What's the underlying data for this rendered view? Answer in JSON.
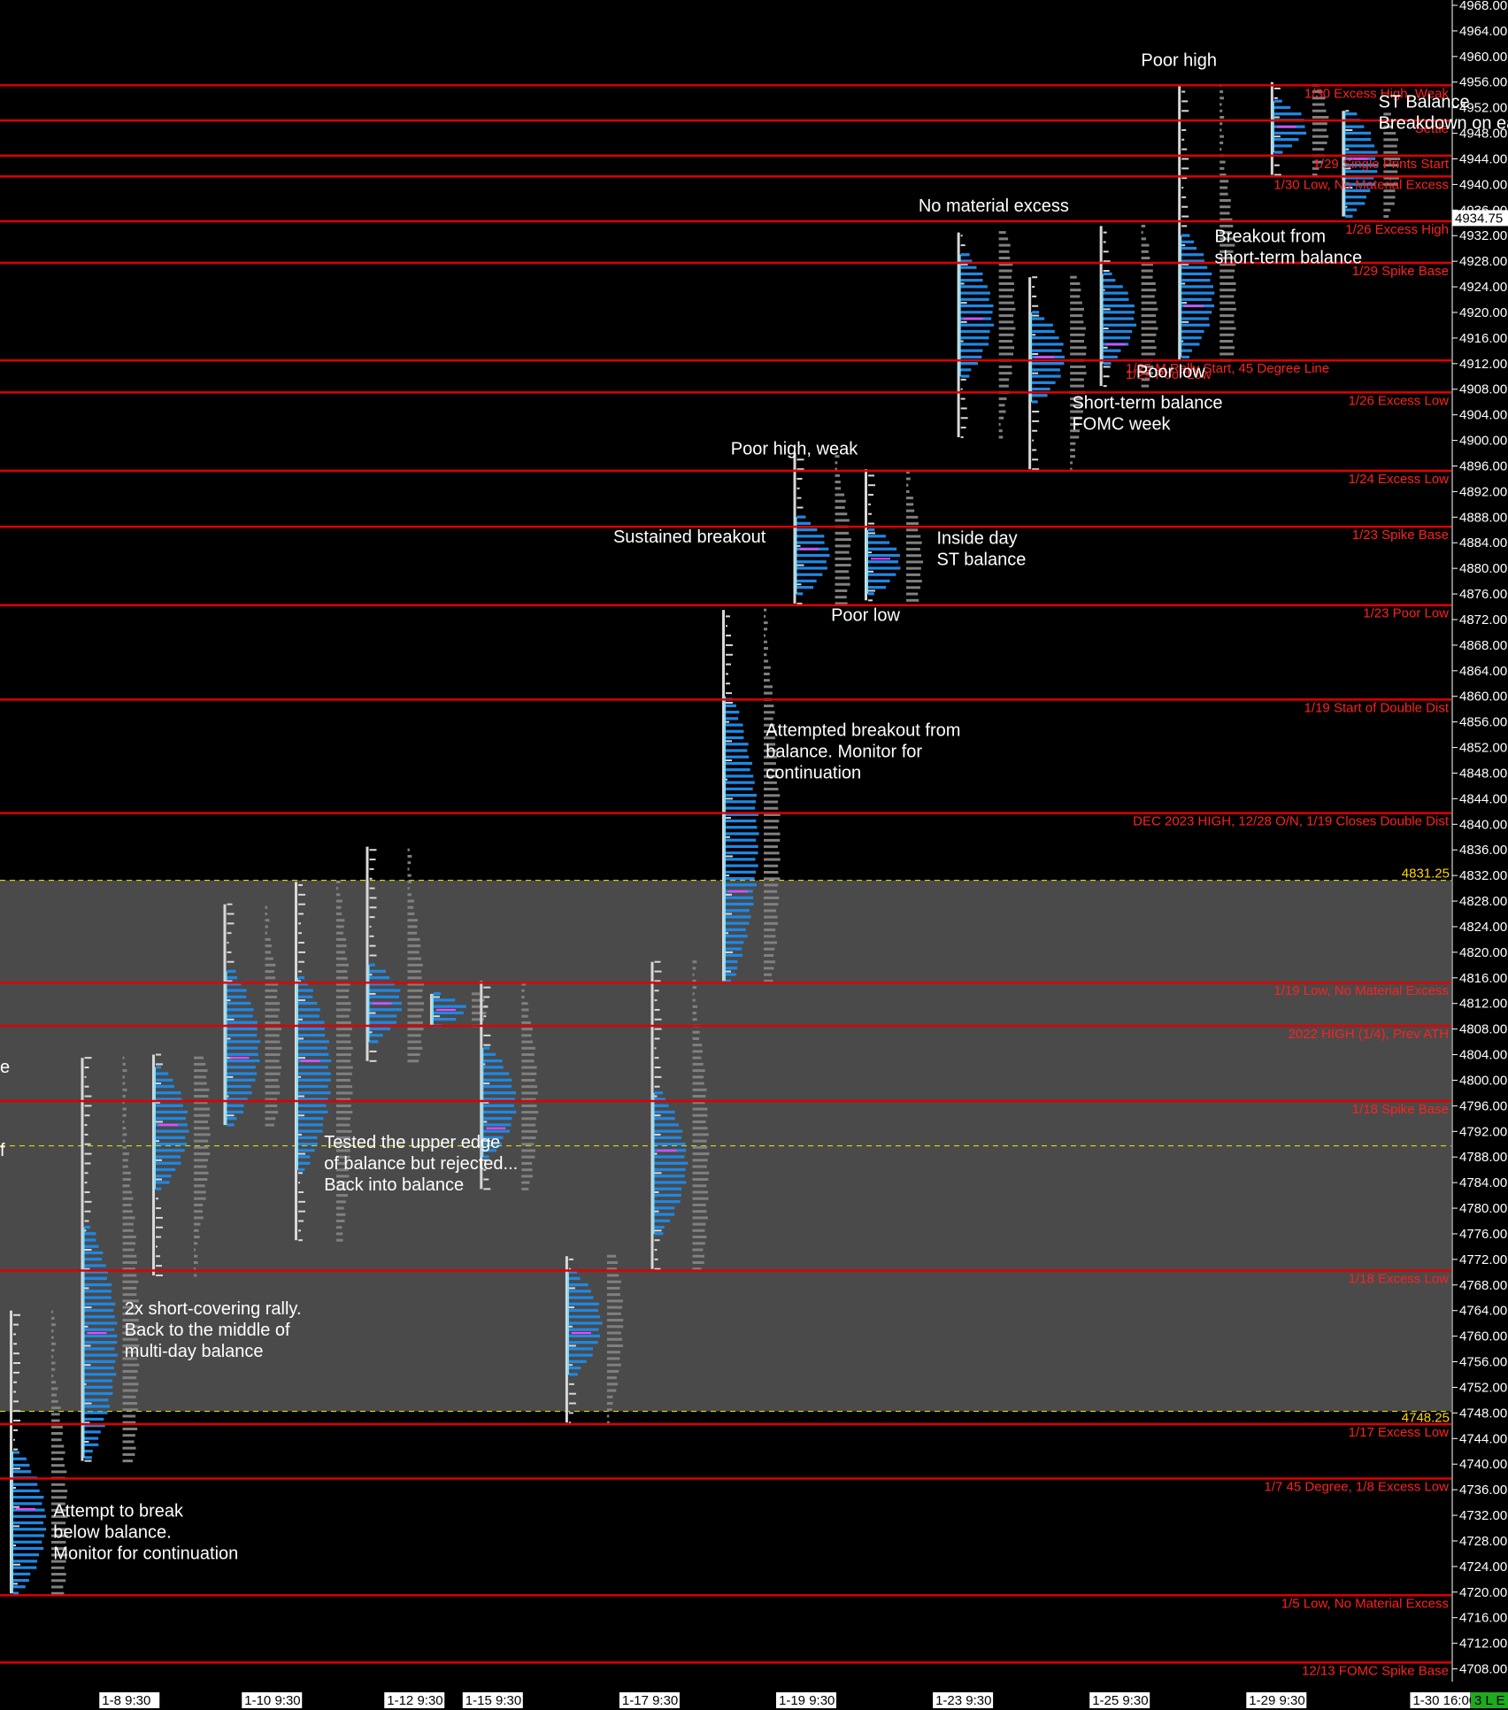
{
  "colors": {
    "background": "#000000",
    "balance_zone": "#4a4a4a",
    "level_line": "#e00000",
    "level_text": "#ff2020",
    "balance_edge": "#dddd00",
    "tpo_blue": "#1e88e5",
    "tpo_cyan": "#7fe0ff",
    "tpo_white": "#d8d8d8",
    "volume_gray": "#808080",
    "poc": "#ff40ff",
    "text": "#ffffff"
  },
  "chart_data": {
    "type": "market-profile",
    "ylim": [
      4706,
      4968
    ],
    "y_tick_step": 4,
    "balance_zone": {
      "low": 4748.25,
      "high": 4831.25
    },
    "balance_mid": 4789.75,
    "balance_labels": {
      "high": "4831.25",
      "low": "4748.25"
    },
    "last_price": "4934.75",
    "date_labels": [
      {
        "label": "1-8  9:30",
        "x": 0.5
      },
      {
        "label": "1-10  9:30",
        "x": 2.5
      },
      {
        "label": "1-12  9:30",
        "x": 4.5
      },
      {
        "label": "1-15  9:30",
        "x": 5.6
      },
      {
        "label": "1-17  9:30",
        "x": 7.8
      },
      {
        "label": "1-19  9:30",
        "x": 10.0
      },
      {
        "label": "1-23  9:30",
        "x": 12.2
      },
      {
        "label": "1-25  9:30",
        "x": 14.4
      },
      {
        "label": "1-29  9:30",
        "x": 16.6
      },
      {
        "label": "1-30  16:00",
        "x": 18.9
      }
    ],
    "corner_badge": "3 L E",
    "levels": [
      {
        "price": 4955.5,
        "label": "1/30 Excess High, Weak"
      },
      {
        "price": 4950.0,
        "label": "Settle"
      },
      {
        "price": 4944.5,
        "label": "1/29 Single Prints Start"
      },
      {
        "price": 4941.25,
        "label": "1/30 Low, No Material Excess"
      },
      {
        "price": 4934.25,
        "label": "1/26 Excess High"
      },
      {
        "price": 4927.75,
        "label": "1/29 Spike Base"
      },
      {
        "price": 4912.5,
        "label": "1/25 M Rally Start, 45 Degree Line"
      },
      {
        "price": 4907.5,
        "label": "1/26 Excess Low"
      },
      {
        "price": 4895.25,
        "label": "1/24 Excess Low"
      },
      {
        "price": 4886.5,
        "label": "1/23 Spike Base"
      },
      {
        "price": 4874.25,
        "label": "1/23 Poor Low"
      },
      {
        "price": 4859.5,
        "label": "1/19 Start of Double Dist"
      },
      {
        "price": 4841.75,
        "label": "DEC 2023 HIGH, 12/28 O/N, 1/19 Closes Double Dist"
      },
      {
        "price": 4815.25,
        "label": "1/19 Low, No Material Excess"
      },
      {
        "price": 4808.5,
        "label": "2022 HIGH (1/4), Prev ATH"
      },
      {
        "price": 4796.75,
        "label": "1/18 Spike Base"
      },
      {
        "price": 4770.25,
        "label": "1/18 Excess Low"
      },
      {
        "price": 4746.25,
        "label": "1/17 Excess Low"
      },
      {
        "price": 4737.75,
        "label": "1/7 45 Degree, 1/8 Excess Low"
      },
      {
        "price": 4719.5,
        "label": "1/5 Low, No Material Excess"
      },
      {
        "price": 4709.0,
        "label": "12/13 FOMC Spike Base"
      }
    ],
    "extra_level_label": {
      "label": "1/29 Poor Low",
      "price": 4910.3
    },
    "sessions": [
      {
        "day": 0,
        "low": 4719.8,
        "high": 4764.0,
        "tpo_low": 4719.8,
        "tpo_high": 4742.0,
        "poc": 4733.0
      },
      {
        "day": 1,
        "low": 4740.5,
        "high": 4803.5,
        "tpo_low": 4741.0,
        "tpo_high": 4777.0,
        "poc": 4760.5
      },
      {
        "day": 2,
        "low": 4769.5,
        "high": 4804.0,
        "tpo_low": 4783.0,
        "tpo_high": 4802.0,
        "poc": 4793.0
      },
      {
        "day": 3,
        "low": 4793.0,
        "high": 4827.5,
        "tpo_low": 4793.0,
        "tpo_high": 4817.0,
        "poc": 4803.5
      },
      {
        "day": 4,
        "low": 4775.0,
        "high": 4831.0,
        "tpo_low": 4786.0,
        "tpo_high": 4816.0,
        "poc": 4803.0
      },
      {
        "day": 5,
        "low": 4803.0,
        "high": 4836.5,
        "tpo_low": 4806.0,
        "tpo_high": 4818.0,
        "poc": 4812.0
      },
      {
        "day": 5.9,
        "low": 4808.5,
        "high": 4813.5,
        "tpo_low": 4808.5,
        "tpo_high": 4813.5,
        "poc": 4811.0
      },
      {
        "day": 6.6,
        "low": 4783.0,
        "high": 4815.5,
        "tpo_low": 4788.0,
        "tpo_high": 4805.0,
        "poc": 4792.5
      },
      {
        "day": 7.8,
        "low": 4746.5,
        "high": 4772.5,
        "tpo_low": 4754.0,
        "tpo_high": 4770.0,
        "poc": 4760.5
      },
      {
        "day": 9.0,
        "low": 4770.5,
        "high": 4818.5,
        "tpo_low": 4776.0,
        "tpo_high": 4798.0,
        "poc": 4789.0
      },
      {
        "day": 10.0,
        "low": 4815.5,
        "high": 4873.5,
        "tpo_low": 4815.5,
        "tpo_high": 4860.0,
        "poc": 4829.5
      },
      {
        "day": 11.0,
        "low": 4874.5,
        "high": 4898.0,
        "tpo_low": 4876.0,
        "tpo_high": 4888.0,
        "poc": 4883.0
      },
      {
        "day": 12.0,
        "low": 4875.0,
        "high": 4895.5,
        "tpo_low": 4876.0,
        "tpo_high": 4886.0,
        "poc": 4881.5
      },
      {
        "day": 13.3,
        "low": 4900.5,
        "high": 4932.5,
        "tpo_low": 4910.0,
        "tpo_high": 4929.0,
        "poc": 4919.0
      },
      {
        "day": 14.3,
        "low": 4895.5,
        "high": 4925.5,
        "tpo_low": 4906.0,
        "tpo_high": 4920.0,
        "poc": 4913.0
      },
      {
        "day": 15.3,
        "low": 4908.5,
        "high": 4933.5,
        "tpo_low": 4912.0,
        "tpo_high": 4926.0,
        "poc": 4915.0
      },
      {
        "day": 16.4,
        "low": 4912.5,
        "high": 4955.5,
        "tpo_low": 4913.0,
        "tpo_high": 4932.0,
        "poc": 4921.0
      },
      {
        "day": 17.7,
        "low": 4941.5,
        "high": 4956.0,
        "tpo_low": 4945.0,
        "tpo_high": 4953.0,
        "poc": 4949.0
      },
      {
        "day": 18.7,
        "low": 4935.0,
        "high": 4951.5,
        "tpo_low": 4935.0,
        "tpo_high": 4951.5,
        "poc": 4944.0
      }
    ],
    "annotations": [
      {
        "lines": [
          "Poor high"
        ],
        "day": 16.4,
        "price": 4958.5,
        "align": "middle"
      },
      {
        "lines": [
          "ST Balance",
          "Breakdown on earnings"
        ],
        "day": 19.2,
        "price": 4952.0,
        "align": "start"
      },
      {
        "lines": [
          "No material excess"
        ],
        "day": 13.8,
        "price": 4935.8,
        "align": "middle"
      },
      {
        "lines": [
          "Breakout from",
          "short-term balance"
        ],
        "day": 16.9,
        "price": 4931.0,
        "align": "start"
      },
      {
        "lines": [
          "Poor low"
        ],
        "day": 15.8,
        "price": 4909.8,
        "align": "start"
      },
      {
        "lines": [
          "Short-term balance",
          "FOMC week"
        ],
        "day": 14.9,
        "price": 4905.0,
        "align": "start"
      },
      {
        "lines": [
          "Poor high, weak"
        ],
        "day": 11.0,
        "price": 4897.8,
        "align": "middle"
      },
      {
        "lines": [
          "Sustained breakout"
        ],
        "day": 10.6,
        "price": 4884.0,
        "align": "end"
      },
      {
        "lines": [
          "Inside day",
          "ST balance"
        ],
        "day": 13.0,
        "price": 4883.8,
        "align": "start"
      },
      {
        "lines": [
          "Poor low"
        ],
        "day": 12.0,
        "price": 4871.8,
        "align": "middle"
      },
      {
        "lines": [
          "Attempted breakout from",
          "balance. Monitor for",
          "continuation"
        ],
        "day": 10.6,
        "price": 4853.8,
        "align": "start"
      },
      {
        "lines": [
          "Tested the upper edge",
          "of balance but rejected...",
          "Back into balance"
        ],
        "day": 4.4,
        "price": 4789.4,
        "align": "start"
      },
      {
        "lines": [
          "2x short-covering rally.",
          "Back to the middle of",
          "multi-day balance"
        ],
        "day": 1.6,
        "price": 4763.4,
        "align": "start"
      },
      {
        "lines": [
          "Attempt to break",
          "below balance.",
          "Monitor for continuation"
        ],
        "day": 0.6,
        "price": 4731.8,
        "align": "start"
      }
    ],
    "edge_fragments": [
      {
        "text": "e",
        "price": 4801.2
      },
      {
        "text": "f",
        "price": 4788.2
      }
    ]
  }
}
